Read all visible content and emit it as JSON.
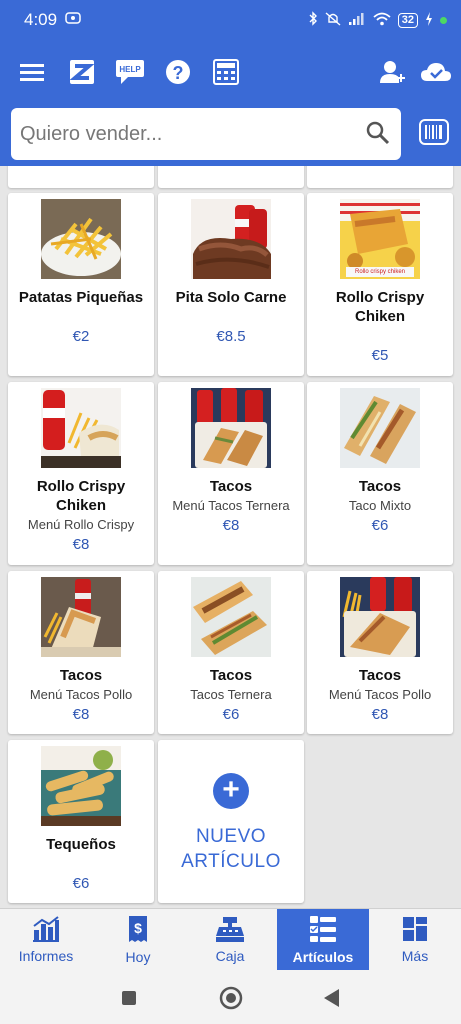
{
  "status": {
    "time": "4:09",
    "battery": "32"
  },
  "toolbar": {
    "icons": [
      "menu-icon",
      "logo-icon",
      "help-chat-icon",
      "question-icon",
      "calculator-icon",
      "add-user-icon",
      "cloud-check-icon"
    ],
    "help_badge": "HELP"
  },
  "search": {
    "placeholder": "Quiero vender..."
  },
  "products": [
    {
      "name": "Patatas Piqueñas",
      "subtitle": "",
      "price": "€2"
    },
    {
      "name": "Pita Solo Carne",
      "subtitle": "",
      "price": "€8.5"
    },
    {
      "name": "Rollo Crispy Chiken",
      "subtitle": "",
      "price": "€5",
      "image_caption": "Rollo crispy chiken"
    },
    {
      "name": "Rollo Crispy Chiken",
      "subtitle": "Menú Rollo Crispy",
      "price": "€8"
    },
    {
      "name": "Tacos",
      "subtitle": "Menú Tacos Ternera",
      "price": "€8"
    },
    {
      "name": "Tacos",
      "subtitle": "Taco Mixto",
      "price": "€6"
    },
    {
      "name": "Tacos",
      "subtitle": "Menú Tacos Pollo",
      "price": "€8"
    },
    {
      "name": "Tacos",
      "subtitle": "Tacos Ternera",
      "price": "€6"
    },
    {
      "name": "Tacos",
      "subtitle": "Menú Tacos Pollo",
      "price": "€8"
    },
    {
      "name": "Tequeños",
      "subtitle": "",
      "price": "€6"
    }
  ],
  "new_item": {
    "line1": "NUEVO",
    "line2": "ARTÍCULO"
  },
  "bottom_nav": [
    {
      "label": "Informes",
      "icon": "chart-icon"
    },
    {
      "label": "Hoy",
      "icon": "receipt-icon"
    },
    {
      "label": "Caja",
      "icon": "cash-register-icon"
    },
    {
      "label": "Artículos",
      "icon": "list-icon",
      "active": true
    },
    {
      "label": "Más",
      "icon": "grid-icon"
    }
  ],
  "colors": {
    "primary": "#3a6ad6",
    "price": "#3057b3"
  }
}
